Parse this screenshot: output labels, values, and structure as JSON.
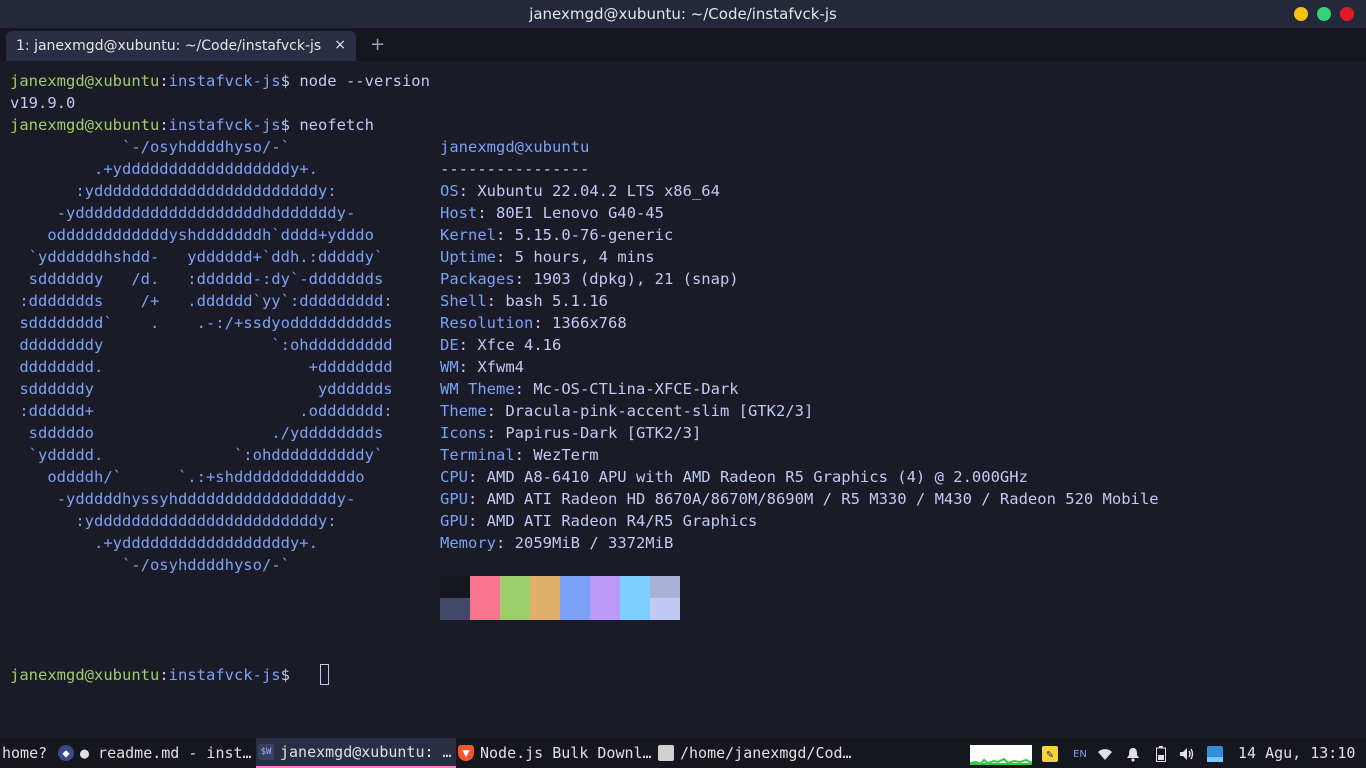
{
  "window": {
    "title": "janexmgd@xubuntu: ~/Code/instafvck-js",
    "buttons": {
      "minimize_color": "#f5c211",
      "maximize_color": "#33d17a",
      "close_color": "#e01b24"
    }
  },
  "tabs": [
    {
      "label": "1: janexmgd@xubuntu: ~/Code/instafvck-js",
      "close": "×"
    }
  ],
  "new_tab": "+",
  "terminal": {
    "prompt_user": "janexmgd@xubuntu",
    "prompt_sep": ":",
    "prompt_dir": "instafvck-js",
    "prompt_end": "$ ",
    "cmd1": "node --version",
    "out1": "v19.9.0",
    "cmd2": "neofetch",
    "logo": [
      "            `-/osyhddddhyso/-`",
      "         .+yddddddddddddddddddy+.",
      "       :yddddddddddddddddddddddddy:",
      "     -yddddddddddddddddddddhdddddddy-",
      "    oddddddddddddyshdddddddh`dddd+ydddo",
      "  `yddddddhshdd-   ydddddd+`ddh.:dddddy`",
      "  sddddddy   /d.   :dddddd-:dy`-ddddddds",
      " :ddddddds    /+   .dddddd`yy`:ddddddddd:",
      " sdddddddd`    .    .-:/+ssdyodddddddddds",
      " ddddddddy                  `:ohddddddddd",
      " dddddddd.                      +dddddddd",
      " sddddddy                        ydddddds",
      " :dddddd+                      .oddddddd:",
      "  sdddddo                   ./ydddddddds",
      "  `yddddd.              `:ohddddddddddy`",
      "    oddddh/`      `.:+shdddddddddddddo",
      "     -ydddddhyssyhdddddddddddddddddy-",
      "       :yddddddddddddddddddddddddy:",
      "         .+yddddddddddddddddddy+.",
      "            `-/osyhddddhyso/-`"
    ],
    "info_title": "janexmgd@xubuntu",
    "info_rule": "----------------",
    "info": [
      {
        "key": "OS",
        "value": "Xubuntu 22.04.2 LTS x86_64"
      },
      {
        "key": "Host",
        "value": "80E1 Lenovo G40-45"
      },
      {
        "key": "Kernel",
        "value": "5.15.0-76-generic"
      },
      {
        "key": "Uptime",
        "value": "5 hours, 4 mins"
      },
      {
        "key": "Packages",
        "value": "1903 (dpkg), 21 (snap)"
      },
      {
        "key": "Shell",
        "value": "bash 5.1.16"
      },
      {
        "key": "Resolution",
        "value": "1366x768"
      },
      {
        "key": "DE",
        "value": "Xfce 4.16"
      },
      {
        "key": "WM",
        "value": "Xfwm4"
      },
      {
        "key": "WM Theme",
        "value": "Mc-OS-CTLina-XFCE-Dark"
      },
      {
        "key": "Theme",
        "value": "Dracula-pink-accent-slim [GTK2/3]"
      },
      {
        "key": "Icons",
        "value": "Papirus-Dark [GTK2/3]"
      },
      {
        "key": "Terminal",
        "value": "WezTerm"
      },
      {
        "key": "CPU",
        "value": "AMD A8-6410 APU with AMD Radeon R5 Graphics (4) @ 2.000GHz"
      },
      {
        "key": "GPU",
        "value": "AMD ATI Radeon HD 8670A/8670M/8690M / R5 M330 / M430 / Radeon 520 Mobile"
      },
      {
        "key": "GPU",
        "value": "AMD ATI Radeon R4/R5 Graphics"
      },
      {
        "key": "Memory",
        "value": "2059MiB / 3372MiB"
      }
    ],
    "palette_top": [
      "#15161e",
      "#f7768e",
      "#9ece6a",
      "#e0af68",
      "#7aa2f7",
      "#bb9af7",
      "#7dcfff",
      "#a9b1d6"
    ],
    "palette_bottom": [
      "#414868",
      "#f7768e",
      "#9ece6a",
      "#e0af68",
      "#7aa2f7",
      "#bb9af7",
      "#7dcfff",
      "#c0caf5"
    ]
  },
  "taskbar": {
    "items": [
      {
        "label": "home?",
        "icon": ""
      },
      {
        "label": "● readme.md - inst…",
        "icon": "vscode-icon"
      },
      {
        "label": "janexmgd@xubuntu: …",
        "icon": "wezterm-icon"
      },
      {
        "label": "Node.js Bulk Downl…",
        "icon": "brave-icon"
      },
      {
        "label": "/home/janexmgd/Cod…",
        "icon": "folder-icon"
      }
    ],
    "tray": {
      "language": "EN",
      "clock": "14 Agu, 13:10"
    }
  }
}
